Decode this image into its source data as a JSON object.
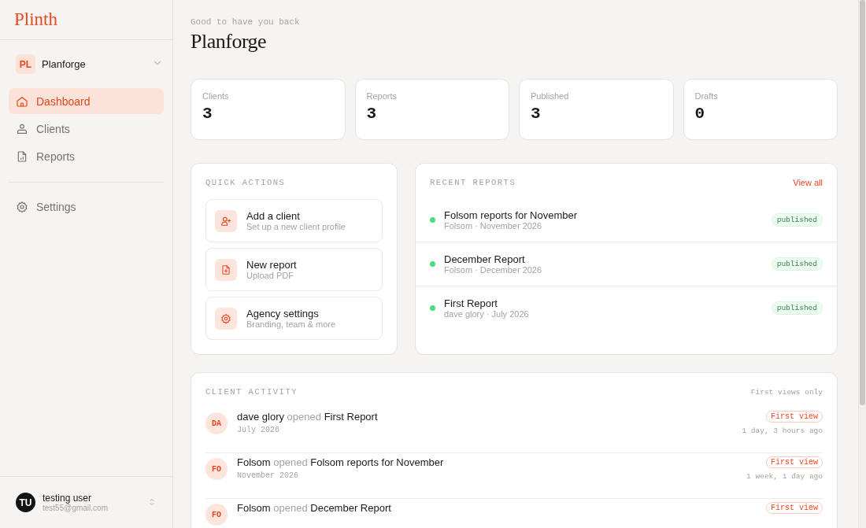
{
  "sidebar": {
    "logo": "Plinth",
    "workspace": {
      "initials": "PL",
      "name": "Planforge"
    },
    "nav": [
      {
        "label": "Dashboard",
        "kind": "home",
        "selected": true
      },
      {
        "label": "Clients",
        "kind": "clients",
        "selected": false
      },
      {
        "label": "Reports",
        "kind": "report",
        "selected": false
      }
    ],
    "secondary_nav": [
      {
        "label": "Settings",
        "kind": "gear",
        "selected": false
      }
    ],
    "user": {
      "initials": "TU",
      "name": "testing user",
      "email": "test55@gmail.com"
    }
  },
  "header": {
    "greeting": "Good to have you back",
    "title": "Planforge"
  },
  "stats": [
    {
      "label": "Clients",
      "value": "3"
    },
    {
      "label": "Reports",
      "value": "3"
    },
    {
      "label": "Published",
      "value": "3"
    },
    {
      "label": "Drafts",
      "value": "0"
    }
  ],
  "quick_actions": {
    "title": "QUICK ACTIONS",
    "items": [
      {
        "kind": "user-plus",
        "title": "Add a client",
        "subtitle": "Set up a new client profile"
      },
      {
        "kind": "file-plus",
        "title": "New report",
        "subtitle": "Upload PDF"
      },
      {
        "kind": "gear",
        "title": "Agency settings",
        "subtitle": "Branding, team & more"
      }
    ]
  },
  "recent_reports": {
    "title": "RECENT REPORTS",
    "link": "View all",
    "items": [
      {
        "title": "Folsom reports for November",
        "meta": "Folsom · November 2026",
        "status": "published",
        "color": "#4ade80"
      },
      {
        "title": "December Report",
        "meta": "Folsom · December 2026",
        "status": "published",
        "color": "#4ade80"
      },
      {
        "title": "First Report",
        "meta": "dave glory · July 2026",
        "status": "published",
        "color": "#4ade80"
      }
    ]
  },
  "client_activity": {
    "title": "CLIENT ACTIVITY",
    "note": "First views only",
    "items": [
      {
        "initials": "DA",
        "actor": "dave glory",
        "action": "opened",
        "report": "First Report",
        "period": "July 2026",
        "badge": "First view",
        "time": "1 day, 3 hours ago"
      },
      {
        "initials": "FO",
        "actor": "Folsom",
        "action": "opened",
        "report": "Folsom reports for November",
        "period": "November 2026",
        "badge": "First view",
        "time": "1 week, 1 day ago"
      },
      {
        "initials": "FO",
        "actor": "Folsom",
        "action": "opened",
        "report": "December Report",
        "badge": "First view"
      }
    ]
  }
}
